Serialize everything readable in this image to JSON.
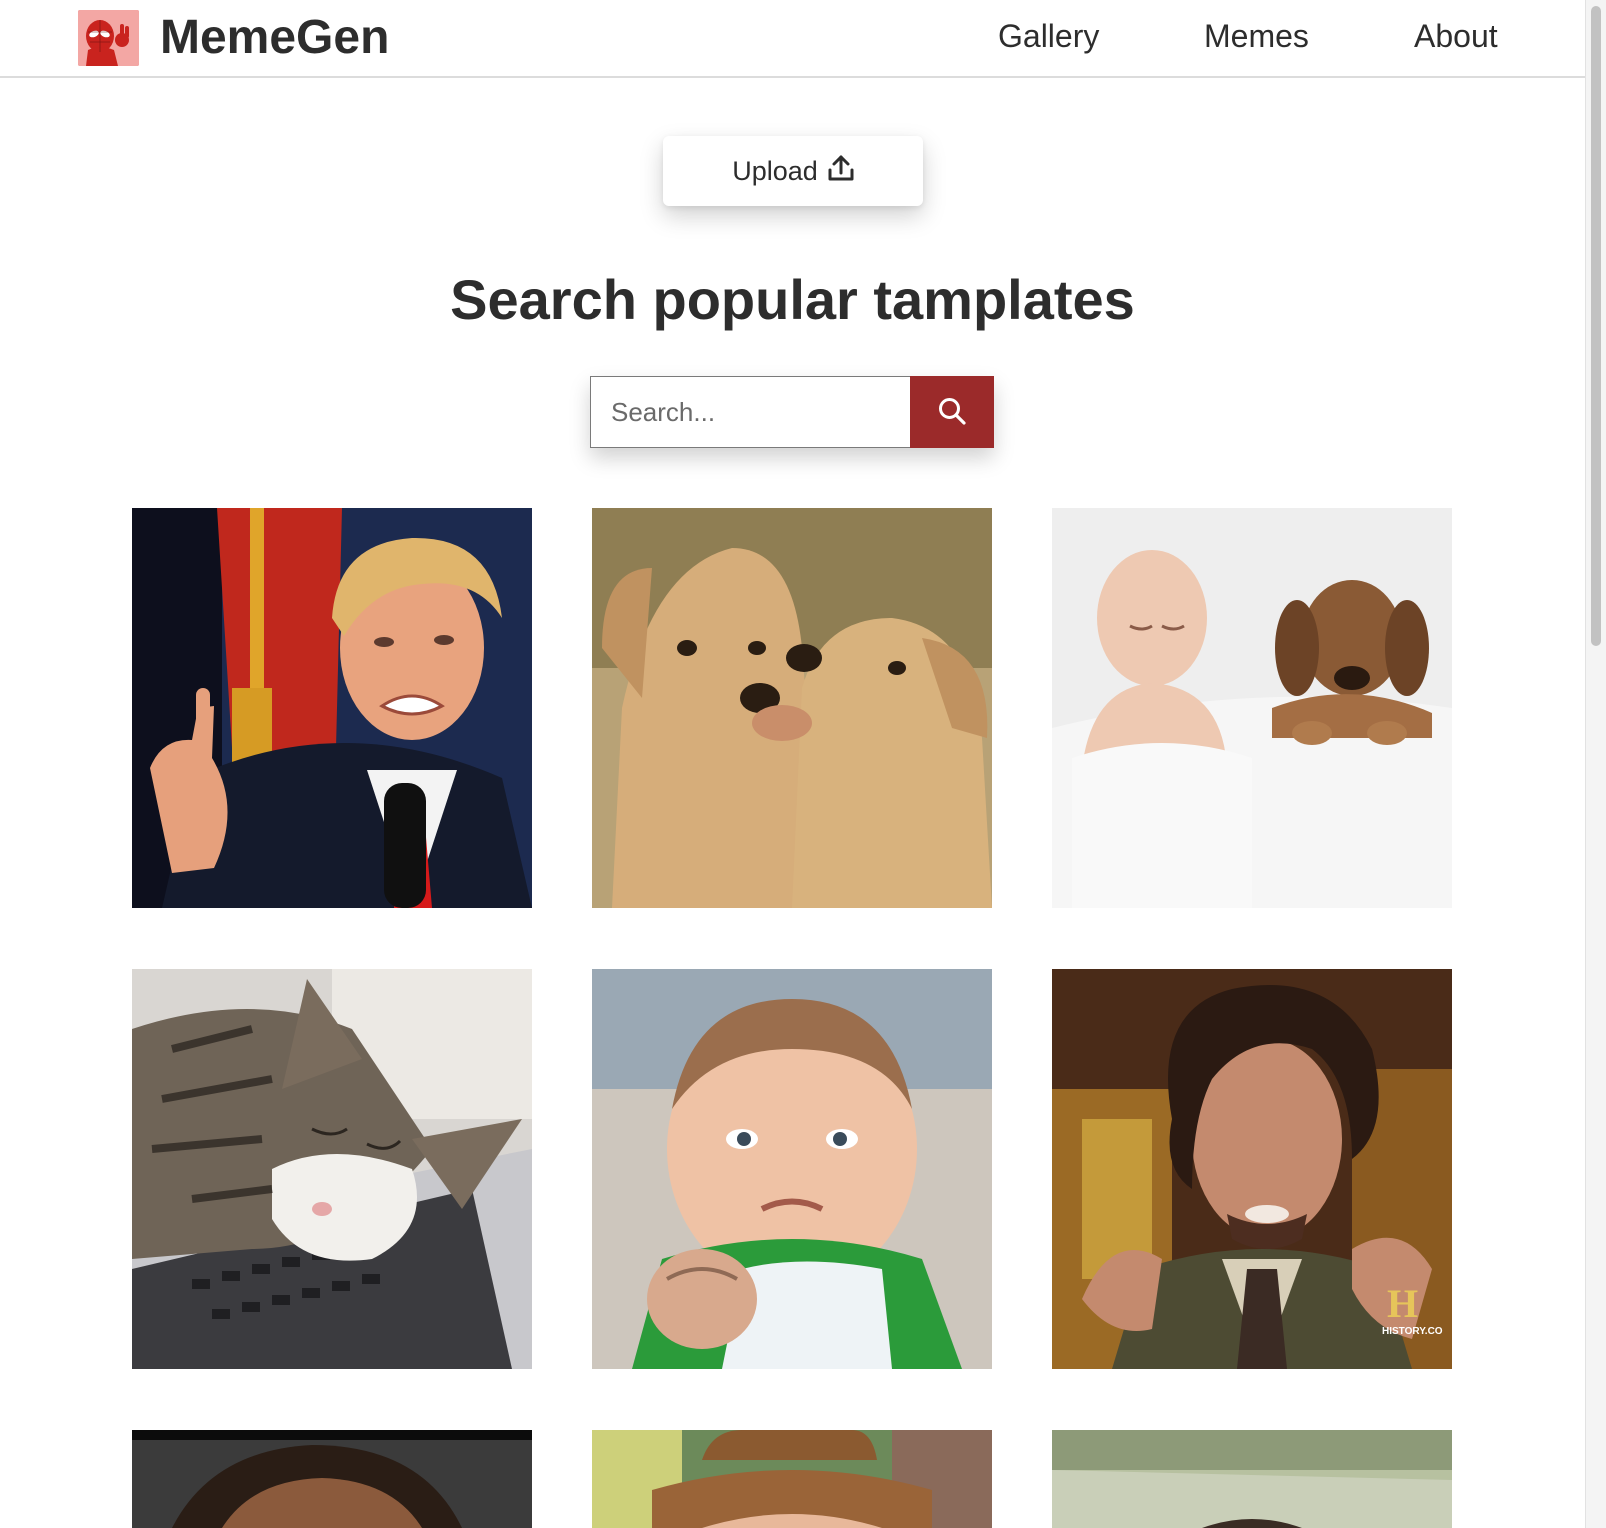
{
  "navbar": {
    "brand": "MemeGen",
    "links": [
      "Gallery",
      "Memes",
      "About"
    ]
  },
  "upload": {
    "label": "Upload"
  },
  "heading": "Search popular tamplates",
  "search": {
    "placeholder": "Search..."
  },
  "colors": {
    "accent": "#9b2a2a",
    "text": "#2d2d2d"
  },
  "icons": {
    "logo": "spiderman-logo-icon",
    "upload": "upload-icon",
    "search": "search-icon"
  },
  "history_watermark": {
    "letter": "H",
    "text": "HISTORY.CO"
  }
}
